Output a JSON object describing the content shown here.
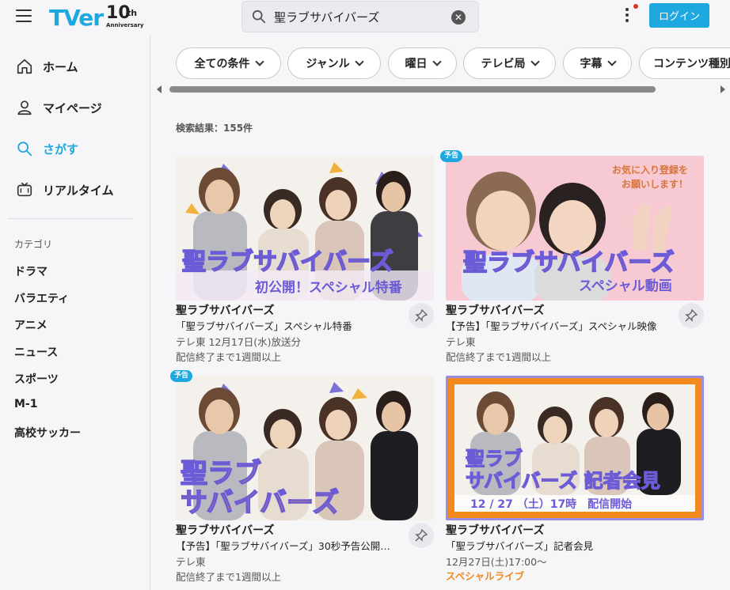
{
  "header": {
    "logo_text": "TVer",
    "logo_anniv_num": "10",
    "logo_anniv_th": "th",
    "logo_anniv_word": "Anniversary",
    "search_value": "聖ラブサバイバーズ",
    "clear_glyph": "✕",
    "login_label": "ログイン",
    "accent": "#1ea8e0"
  },
  "sidebar": {
    "nav": [
      {
        "label": "ホーム",
        "icon": "home-icon"
      },
      {
        "label": "マイページ",
        "icon": "user-icon"
      },
      {
        "label": "さがす",
        "icon": "search-icon",
        "active": true
      },
      {
        "label": "リアルタイム",
        "icon": "tv-icon"
      }
    ],
    "category_title": "カテゴリ",
    "categories": [
      "ドラマ",
      "バラエティ",
      "アニメ",
      "ニュース",
      "スポーツ",
      "M-1",
      "高校サッカー"
    ]
  },
  "filters": [
    "全ての条件",
    "ジャンル",
    "曜日",
    "テレビ局",
    "字幕",
    "コンテンツ種別"
  ],
  "results": {
    "count_label": "検索結果：155件"
  },
  "cards": [
    {
      "badge": "",
      "title": "聖ラブサバイバーズ",
      "subtitle": "「聖ラブサバイバーズ」スペシャル特番",
      "line1": "テレ東 12月17日(水)放送分",
      "line2": "配信終了まで1週間以上",
      "thumb_logo": "聖ラブサバイバーズ",
      "thumb_caption": "初公開！スペシャル特番"
    },
    {
      "badge": "予告",
      "title": "聖ラブサバイバーズ",
      "subtitle": "【予告】「聖ラブサバイバーズ」スペシャル映像",
      "line1": "テレ東",
      "line2": "配信終了まで1週間以上",
      "thumb_logo": "聖ラブサバイバーズ",
      "thumb_caption": "スペシャル動画",
      "thumb_note": "お気に入り登録を\nお願いします！"
    },
    {
      "badge": "予告",
      "title": "聖ラブサバイバーズ",
      "subtitle": "【予告】「聖ラブサバイバーズ」30秒予告公開…",
      "line1": "テレ東",
      "line2": "配信終了まで1週間以上",
      "thumb_logo_line1": "聖ラブ",
      "thumb_logo_line2": "サバイバーズ"
    },
    {
      "badge": "",
      "title": "聖ラブサバイバーズ",
      "subtitle": "「聖ラブサバイバーズ」記者会見",
      "line1": "12月27日(土)17:00〜",
      "line2": "スペシャルライブ",
      "thumb_logo_line1": "聖ラブ",
      "thumb_logo_line2": "サバイバーズ 記者会見",
      "thumb_caption": "12 / 27 （土）17時　配信開始"
    }
  ]
}
